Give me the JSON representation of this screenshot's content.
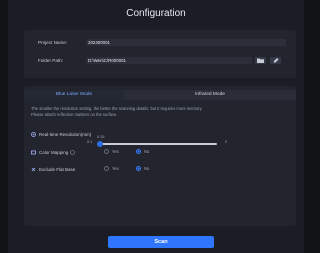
{
  "window": {
    "title": "Configuration"
  },
  "project": {
    "name_label": "Project Name:",
    "name_value": "202400001",
    "folder_label": "Folder Path:",
    "folder_value": "D:\\Wen\\C\\R000001"
  },
  "tabs": [
    {
      "label": "Blue Laser Mode",
      "active": true
    },
    {
      "label": "Infrared Mode",
      "active": false
    }
  ],
  "hint": {
    "line1": "The smaller the resolution setting, the better the scanning details, but it requires more memory.",
    "line2": "Please attach reflective markers on the surface."
  },
  "resolution": {
    "label": "Real-time Resolution(mm)",
    "min": "0.1",
    "max": "2",
    "value": "0.15",
    "level_fraction": 0.026
  },
  "options": [
    {
      "label": "Color Mapping",
      "yes": "Yes",
      "no": "No",
      "selected": "No"
    },
    {
      "label": "Exclude Flat Base",
      "yes": "Yes",
      "no": "No",
      "selected": "No"
    }
  ],
  "actions": {
    "scan_label": "Scan"
  },
  "colors": {
    "accent": "#2f76ff",
    "window_bg": "#1b1d24",
    "panel_bg": "#22252e"
  }
}
